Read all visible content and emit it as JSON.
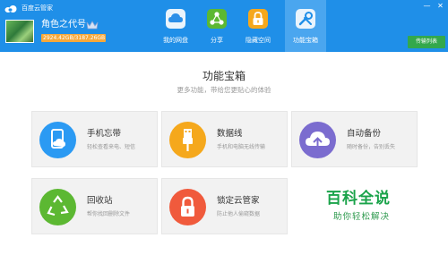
{
  "app": {
    "title": "百度云管家"
  },
  "user": {
    "name": "角色之代号",
    "quota": "2924.42GB/3187.26GB"
  },
  "nav": {
    "tabs": [
      {
        "label": "我的网盘",
        "icon": "cloud-icon"
      },
      {
        "label": "分享",
        "icon": "share-icon"
      },
      {
        "label": "隐藏空间",
        "icon": "lock-icon"
      },
      {
        "label": "功能宝箱",
        "icon": "toolbox-icon"
      }
    ],
    "active": "功能宝箱"
  },
  "window_controls": {
    "minimize": "—",
    "close": "✕"
  },
  "transfer_button": "传输列表",
  "main": {
    "title": "功能宝箱",
    "subtitle": "更多功能，带给您更贴心的体验",
    "cards": [
      {
        "title": "手机忘带",
        "desc": "轻松查看来电、短信",
        "icon": "phone-cloud-icon",
        "color": "#2b9af3"
      },
      {
        "title": "数据线",
        "desc": "手机和电脑无线传输",
        "icon": "usb-cable-icon",
        "color": "#f5a81c"
      },
      {
        "title": "自动备份",
        "desc": "随时备份，告别丢失",
        "icon": "cloud-upload-icon",
        "color": "#7b6ccf"
      },
      {
        "title": "回收站",
        "desc": "帮你找回删除文件",
        "icon": "recycle-icon",
        "color": "#5cb832"
      },
      {
        "title": "锁定云管家",
        "desc": "防止他人偷窥数据",
        "icon": "padlock-icon",
        "color": "#f05a3c"
      }
    ]
  },
  "watermark": {
    "title": "百科全说",
    "subtitle": "助你轻松解决"
  }
}
